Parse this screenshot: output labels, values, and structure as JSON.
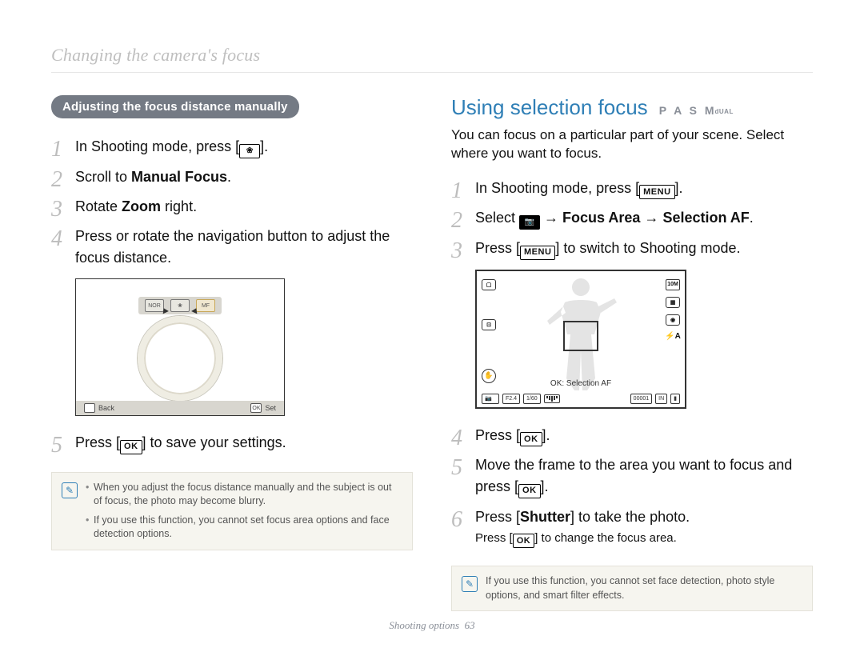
{
  "header": "Changing the camera's focus",
  "left": {
    "pill": "Adjusting the focus distance manually",
    "steps": [
      {
        "pre": "In Shooting mode, press [",
        "icon": "flower",
        "post": "]."
      },
      {
        "text_pre": "Scroll to ",
        "bold": "Manual Focus",
        "text_post": "."
      },
      {
        "text_pre": "Rotate ",
        "bold": "Zoom",
        "text_post": " right."
      },
      {
        "text": "Press or rotate the navigation button to adjust the focus distance."
      },
      {
        "pre": "Press [",
        "icon": "OK",
        "post": "] to save your settings."
      }
    ],
    "figure": {
      "tb1": "NOR",
      "tb2": "❀",
      "tb3": "MF",
      "bb_back_icon": "◼",
      "bb_back": "Back",
      "bb_ok_icon": "OK",
      "bb_set": "Set"
    },
    "notes": [
      "When you adjust the focus distance manually and the subject is out of focus, the photo may become blurry.",
      "If you use this function, you cannot set focus area options and face detection options."
    ]
  },
  "right": {
    "title": "Using selection focus",
    "modes": "P A S M",
    "modes_extra": "dUAL",
    "intro": "You can focus on a particular part of your scene. Select where you want to focus.",
    "steps": [
      {
        "pre": "In Shooting mode, press [",
        "icon": "MENU",
        "post": "]."
      },
      {
        "text_pre": "Select ",
        "cam_icon": true,
        "arrow": " → ",
        "bold1": "Focus Area",
        "bold2": "Selection AF",
        "text_post": "."
      },
      {
        "pre": "Press [",
        "icon": "MENU",
        "post": "] to switch to Shooting mode."
      },
      {
        "pre": "Press [",
        "icon": "OK",
        "post": "]."
      },
      {
        "pre": "Move the frame to the area you want to focus and press [",
        "icon": "OK",
        "post": "]."
      },
      {
        "text_pre": "Press [",
        "bold": "Shutter",
        "text_post": "] to take the photo.",
        "sub_pre": "Press [",
        "sub_icon": "OK",
        "sub_post": "] to change the focus area."
      }
    ],
    "figure": {
      "ri_top": "10M",
      "ri_flash": "⚡A",
      "ok_label": "OK: Selection AF",
      "sb_f": "F2.4",
      "sb_sh": "1/60",
      "sb_count": "00001",
      "sb_in": "IN"
    },
    "note": "If you use this function, you cannot set face detection, photo style options, and smart filter effects."
  },
  "footer": {
    "label": "Shooting options",
    "page": "63"
  }
}
